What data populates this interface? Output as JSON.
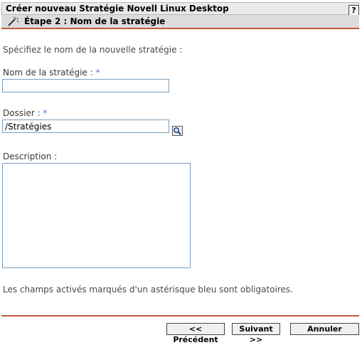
{
  "window": {
    "title": "Créer nouveau Stratégie Novell Linux Desktop",
    "help_label": "?"
  },
  "step": {
    "title": "Étape 2 : Nom de la stratégie",
    "icon": "wizard-wand-icon"
  },
  "form": {
    "intro": "Spécifiez le nom de la nouvelle stratégie :",
    "required_marker": "*",
    "name_label": "Nom de la stratégie :",
    "name_value": "",
    "folder_label": "Dossier :",
    "folder_value": "/Stratégies",
    "folder_browse_icon": "magnifier-icon",
    "description_label": "Description :",
    "description_value": "",
    "required_note": "Les champs activés marqués d'un astérisque bleu sont obligatoires."
  },
  "buttons": {
    "previous": "<< Précédent",
    "next": "Suivant >>",
    "cancel": "Annuler"
  },
  "colors": {
    "accent_rule": "#c25a3a",
    "required_asterisk": "#4a7bc7",
    "input_border": "#7f9db9"
  }
}
